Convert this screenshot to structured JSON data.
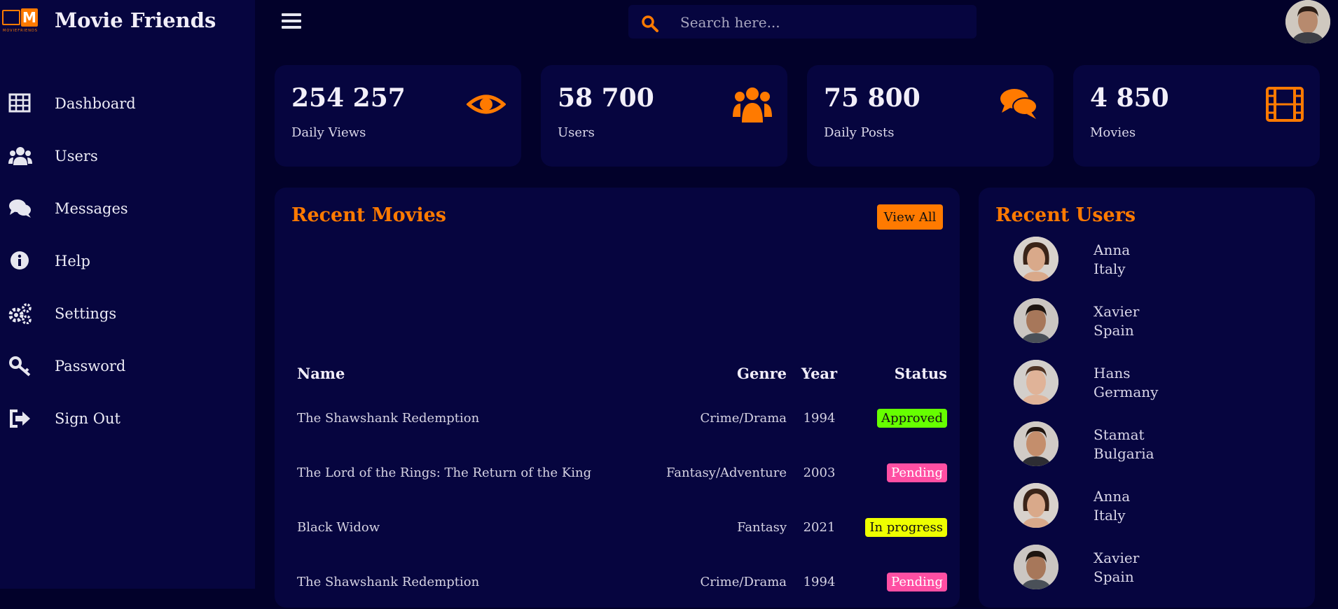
{
  "app": {
    "brand_name": "Movie Friends",
    "logo_letter": "M",
    "logo_small": "MOVIEFRIENDS"
  },
  "sidebar": {
    "items": [
      {
        "label": "Dashboard",
        "icon": "table-icon"
      },
      {
        "label": "Users",
        "icon": "users-icon"
      },
      {
        "label": "Messages",
        "icon": "comments-icon"
      },
      {
        "label": "Help",
        "icon": "info-icon"
      },
      {
        "label": "Settings",
        "icon": "gears-icon"
      },
      {
        "label": "Password",
        "icon": "key-icon"
      },
      {
        "label": "Sign Out",
        "icon": "sign-out-icon"
      }
    ]
  },
  "search": {
    "placeholder": "Search here..."
  },
  "stats": [
    {
      "value": "254 257",
      "label": "Daily Views",
      "icon": "eye-icon"
    },
    {
      "value": "58 700",
      "label": "Users",
      "icon": "users-icon"
    },
    {
      "value": "75 800",
      "label": "Daily Posts",
      "icon": "comments-icon"
    },
    {
      "value": "4 850",
      "label": "Movies",
      "icon": "film-icon"
    }
  ],
  "recent_movies": {
    "title": "Recent Movies",
    "view_all_label": "View All",
    "columns": [
      "Name",
      "Genre",
      "Year",
      "Status"
    ],
    "rows": [
      {
        "name": "The Shawshank Redemption",
        "genre": "Crime/Drama",
        "year": "1994",
        "status": "Approved"
      },
      {
        "name": "The Lord of the Rings: The Return of the King",
        "genre": "Fantasy/Adventure",
        "year": "2003",
        "status": "Pending"
      },
      {
        "name": "Black Widow",
        "genre": "Fantasy",
        "year": "2021",
        "status": "In progress"
      },
      {
        "name": "The Shawshank Redemption",
        "genre": "Crime/Drama",
        "year": "1994",
        "status": "Pending"
      }
    ]
  },
  "recent_users": {
    "title": "Recent Users",
    "users": [
      {
        "name": "Anna",
        "country": "Italy"
      },
      {
        "name": "Xavier",
        "country": "Spain"
      },
      {
        "name": "Hans",
        "country": "Germany"
      },
      {
        "name": "Stamat",
        "country": "Bulgaria"
      },
      {
        "name": "Anna",
        "country": "Italy"
      },
      {
        "name": "Xavier",
        "country": "Spain"
      }
    ]
  },
  "colors": {
    "accent": "#ff7a00",
    "background": "#02012a",
    "panel": "#06053f",
    "status_approved": "#66ff00",
    "status_pending": "#ff4fa3",
    "status_in_progress": "#eeff00"
  }
}
